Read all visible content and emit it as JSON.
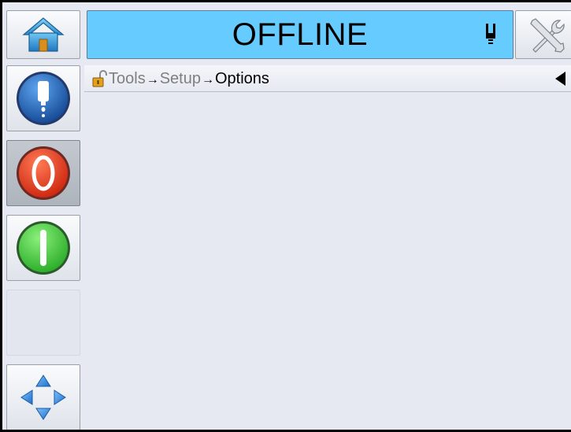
{
  "header": {
    "status_text": "OFFLINE",
    "status_color": "#66ccff",
    "home_icon": "home-icon",
    "status_icon": "printhead-icon",
    "tools_icon": "tools-icon"
  },
  "sidebar": {
    "buttons": [
      {
        "icon": "ink-cartridge-icon",
        "color": "#1f5fb8"
      },
      {
        "icon": "stop-icon",
        "color": "#e83a1f"
      },
      {
        "icon": "start-icon",
        "color": "#3ac83a"
      },
      {
        "icon": "",
        "color": ""
      },
      {
        "icon": "navigation-arrows-icon",
        "color": "#3d8fe0"
      }
    ]
  },
  "breadcrumb": {
    "lock_icon": "padlock-open-icon",
    "items": [
      "Tools",
      "Setup",
      "Options"
    ],
    "separator": "→",
    "collapse_icon": "triangle-left-icon"
  }
}
